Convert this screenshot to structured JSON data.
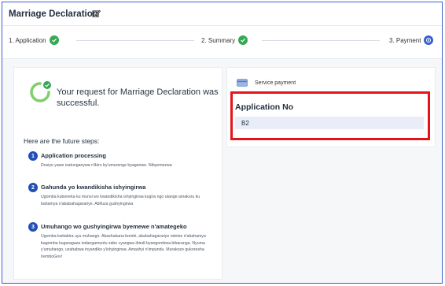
{
  "header": {
    "title": "Marriage Declaration",
    "edit_icon": "edit-icon"
  },
  "steps": [
    {
      "label": "1. Application",
      "status": "done"
    },
    {
      "label": "2. Summary",
      "status": "done"
    },
    {
      "label": "3. Payment",
      "status": "active"
    }
  ],
  "colors": {
    "accent": "#3b5fd0",
    "success": "#34a853",
    "highlight": "#e4141b",
    "step_number": "#1f4fb8"
  },
  "success": {
    "message": "Your request for Marriage Declaration was successful."
  },
  "future_steps": {
    "heading": "Here are the future steps:",
    "items": [
      {
        "number": "1",
        "title": "Application processing",
        "description": "Dosiye yawe izatunganywa n'ibiro by'umurenge byagenwe. Nibyemezwa"
      },
      {
        "number": "2",
        "title": "Gahunda yo kwandikisha ishyingirwa",
        "description": "Ugomba kuboneka ku munsi wo kwandikisha ishyingirwa kugira ngo utange amakuru ku bahamya n'ababahagarariye. Abifuza gushyingirwa"
      },
      {
        "number": "3",
        "title": "Umuhango wo gushyingirwa byemewe n'amategeko",
        "description": "Ugomba kwitabira uyu muhango. Abashakana bombi, ababahagarariye ndetse n'abahamya bagomba kugaragaza indangamuntu zabo cyangwa ibindi byangombwa bibaranga. Nyuma y'umuhango, uzahabwa inyandiko y'ishyingirwa. Amashyi n'impundu. Murakoze gukoresha IremboGov!"
      }
    ]
  },
  "payment": {
    "service_label": "Service payment",
    "app_no_label": "Application No",
    "app_no_value": "B2"
  }
}
